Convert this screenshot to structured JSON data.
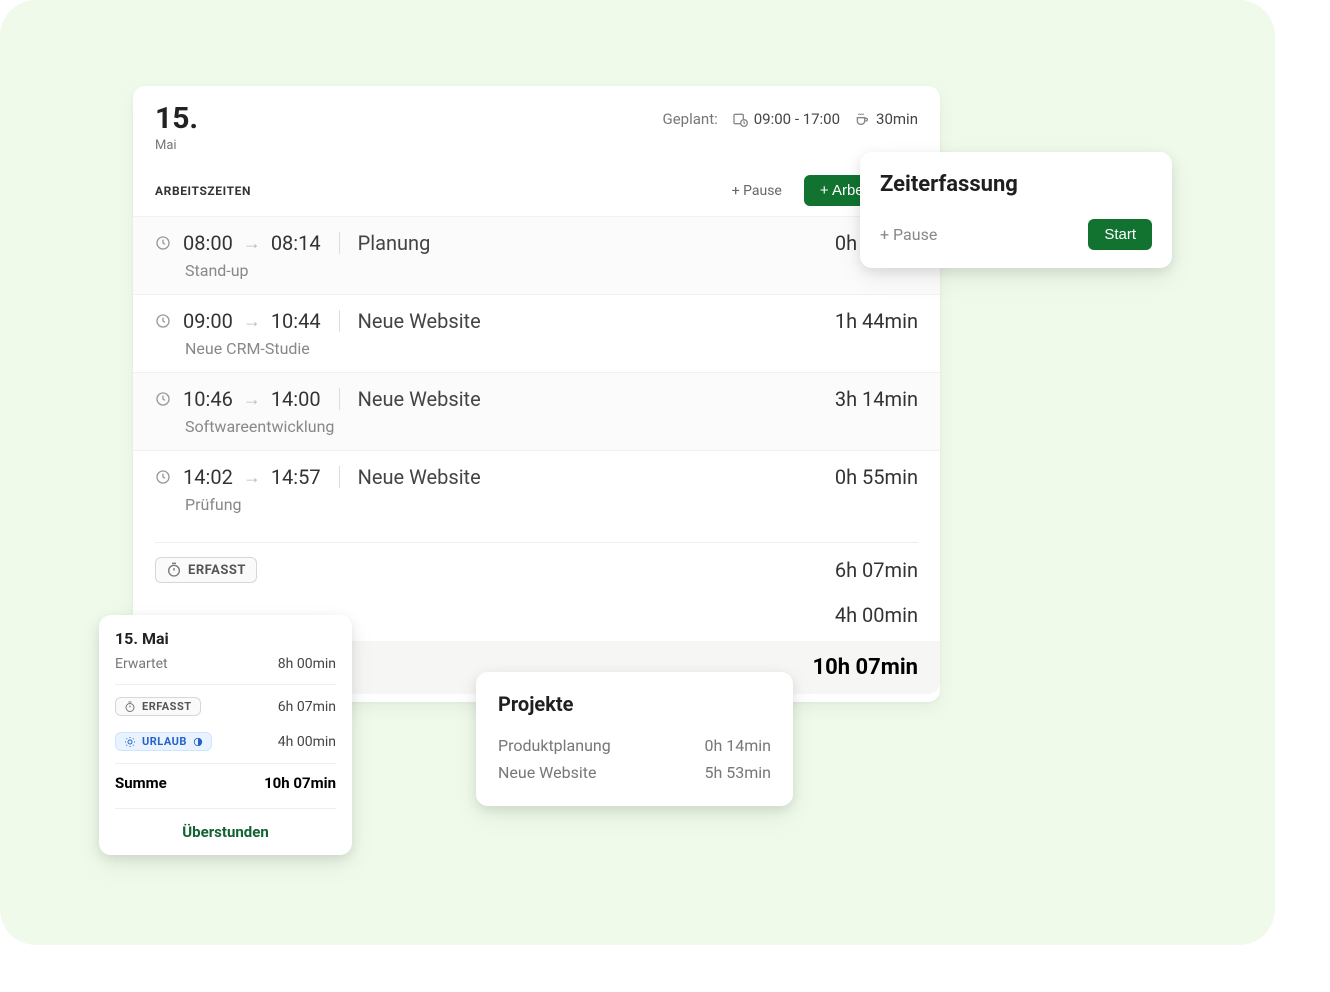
{
  "header": {
    "day": "15.",
    "month": "Mai",
    "planned_label": "Geplant:",
    "planned_time": "09:00 - 17:00",
    "planned_break": "30min",
    "toolbar": {
      "section_label": "ARBEITSZEITEN",
      "add_pause": "+ Pause",
      "add_work": "+ Arbeitszeit"
    }
  },
  "entries": [
    {
      "start": "08:00",
      "end": "08:14",
      "project": "Planung",
      "note": "Stand-up",
      "duration": "0h 14min"
    },
    {
      "start": "09:00",
      "end": "10:44",
      "project": "Neue Website",
      "note": "Neue CRM-Studie",
      "duration": "1h 44min"
    },
    {
      "start": "10:46",
      "end": "14:00",
      "project": "Neue Website",
      "note": "Softwareentwicklung",
      "duration": "3h 14min"
    },
    {
      "start": "14:02",
      "end": "14:57",
      "project": "Neue Website",
      "note": "Prüfung",
      "duration": "0h 55min"
    }
  ],
  "summaries": {
    "recorded_badge": "ERFASST",
    "recorded_value": "6h 07min",
    "row2_value": "4h 00min",
    "total_value": "10h 07min"
  },
  "tracker": {
    "title": "Zeiterfassung",
    "pause": "+ Pause",
    "start": "Start"
  },
  "summary_card": {
    "title": "15. Mai",
    "expected_label": "Erwartet",
    "expected_value": "8h 00min",
    "recorded_badge": "ERFASST",
    "recorded_value": "6h 07min",
    "vacation_badge": "URLAUB",
    "vacation_value": "4h 00min",
    "sum_label": "Summe",
    "sum_value": "10h 07min",
    "overtime_label": "Überstunden"
  },
  "projects_card": {
    "title": "Projekte",
    "rows": [
      {
        "name": "Produktplanung",
        "value": "0h 14min"
      },
      {
        "name": "Neue Website",
        "value": "5h 53min"
      }
    ]
  }
}
